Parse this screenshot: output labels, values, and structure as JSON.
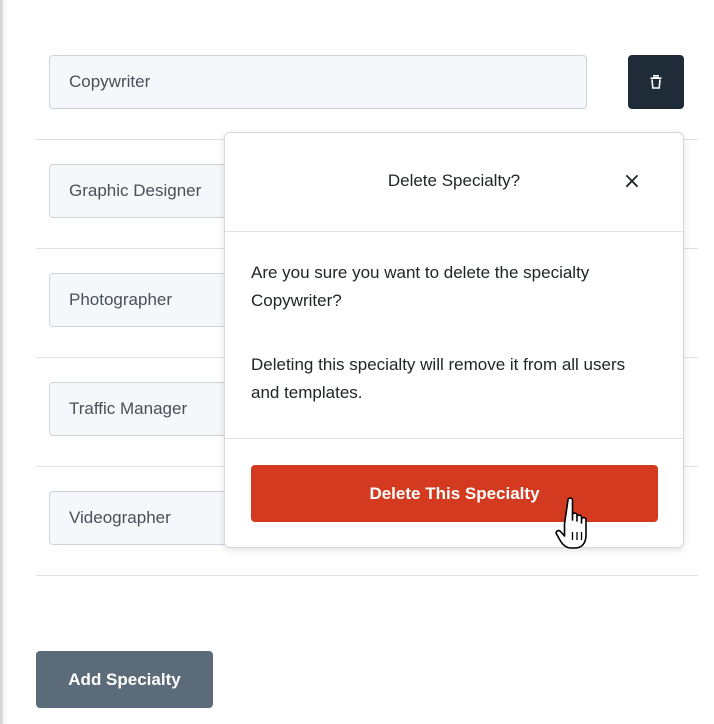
{
  "specialties": [
    {
      "value": "Copywriter"
    },
    {
      "value": "Graphic Designer"
    },
    {
      "value": "Photographer"
    },
    {
      "value": "Traffic Manager"
    },
    {
      "value": "Videographer"
    }
  ],
  "trash_icon": "trash-icon",
  "add_button_label": "Add Specialty",
  "dialog": {
    "title": "Delete Specialty?",
    "close_label": "×",
    "message_line1": "Are you sure you want to delete the specialty Copywriter?",
    "message_line2": "Deleting this specialty will remove it from all users and templates.",
    "confirm_label": "Delete This Specialty"
  },
  "colors": {
    "delete_button": "#d33a1f",
    "trash_button": "#1f2b37",
    "add_button": "#5b6b7a"
  },
  "cursor_icon": "hand-pointer-icon"
}
